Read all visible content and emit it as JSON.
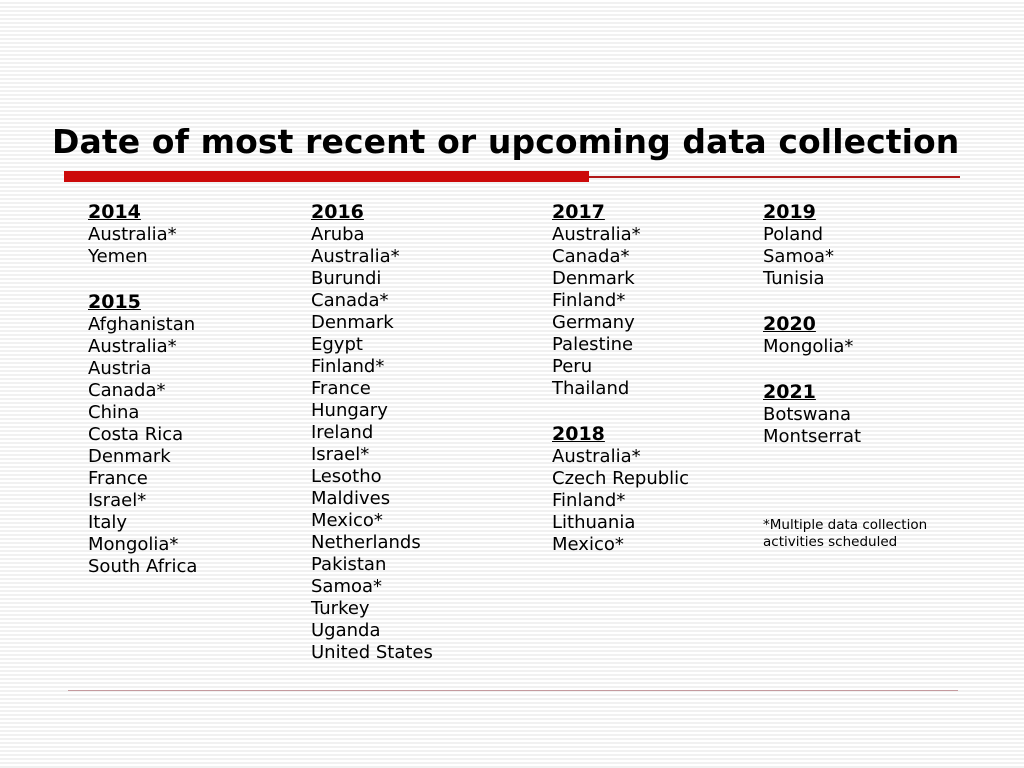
{
  "slide": {
    "title": "Date of most recent or upcoming data collection",
    "accent_color": "#cc0a0a",
    "accent_line_color": "#b01616",
    "footer_rule_color": "#c49a9e",
    "background_color": "#ffffff",
    "text_color": "#000000"
  },
  "columns": [
    {
      "id": "column-1",
      "blocks": [
        {
          "year": "2014",
          "countries": [
            "Australia*",
            "Yemen"
          ]
        },
        {
          "year": "2015",
          "countries": [
            "Afghanistan",
            "Australia*",
            "Austria",
            "Canada*",
            "China",
            "Costa Rica",
            "Denmark",
            "France",
            "Israel*",
            "Italy",
            "Mongolia*",
            "South Africa"
          ]
        }
      ]
    },
    {
      "id": "column-2",
      "blocks": [
        {
          "year": "2016",
          "countries": [
            "Aruba",
            "Australia*",
            "Burundi",
            "Canada*",
            "Denmark",
            "Egypt",
            "Finland*",
            "France",
            "Hungary",
            "Ireland",
            "Israel*",
            "Lesotho",
            "Maldives",
            "Mexico*",
            "Netherlands",
            "Pakistan",
            "Samoa*",
            "Turkey",
            "Uganda",
            "United States"
          ]
        }
      ]
    },
    {
      "id": "column-3",
      "blocks": [
        {
          "year": "2017",
          "countries": [
            "Australia*",
            "Canada*",
            "Denmark",
            "Finland*",
            "Germany",
            "Palestine",
            "Peru",
            "Thailand"
          ]
        },
        {
          "year": "2018",
          "countries": [
            "Australia*",
            "Czech Republic",
            "Finland*",
            "Lithuania",
            "Mexico*"
          ]
        }
      ]
    },
    {
      "id": "column-4",
      "blocks": [
        {
          "year": "2019",
          "countries": [
            "Poland",
            "Samoa*",
            "Tunisia"
          ]
        },
        {
          "year": "2020",
          "countries": [
            "Mongolia*"
          ]
        },
        {
          "year": "2021",
          "countries": [
            "Botswana",
            "Montserrat"
          ]
        }
      ]
    }
  ],
  "footnote": "*Multiple data collection activities scheduled"
}
